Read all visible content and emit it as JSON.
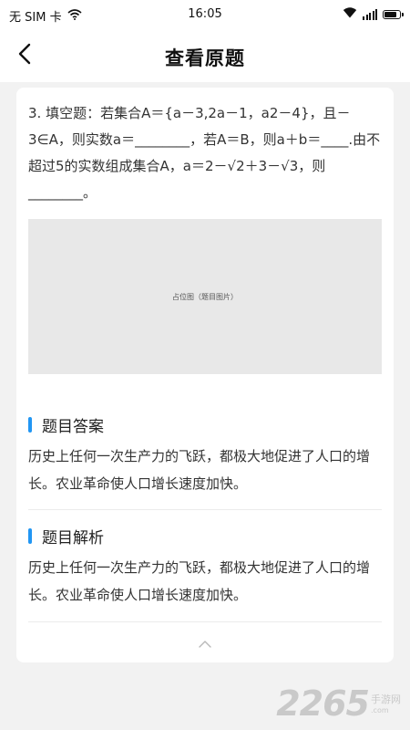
{
  "status_bar": {
    "carrier": "无 SIM 卡",
    "time": "16:05",
    "battery_level": 0.85
  },
  "nav": {
    "title": "查看原题"
  },
  "question": {
    "text": "3. 填空题：若集合A＝{a－3,2a－1，a2－4}，且－3∈A，则实数a＝________，若A＝B，则a＋b＝____.由不超过5的实数组成集合A，a＝2－√2＋3－√3，则________。",
    "image_placeholder": "占位图（题目图片）"
  },
  "answer": {
    "title": "题目答案",
    "body": "历史上任何一次生产力的飞跃，都极大地促进了人口的增长。农业革命使人口增长速度加快。"
  },
  "analysis": {
    "title": "题目解析",
    "body": "历史上任何一次生产力的飞跃，都极大地促进了人口的增长。农业革命使人口增长速度加快。"
  },
  "watermark": {
    "number": "2265",
    "text": "手游网",
    "sub": ".com"
  },
  "colors": {
    "accent": "#2196f3",
    "background": "#f2f2f2",
    "card": "#ffffff"
  },
  "icons": {
    "back": "chevron-left-icon",
    "collapse": "chevron-up-icon",
    "wifi": "wifi-icon",
    "signal": "signal-icon",
    "battery": "battery-icon"
  }
}
